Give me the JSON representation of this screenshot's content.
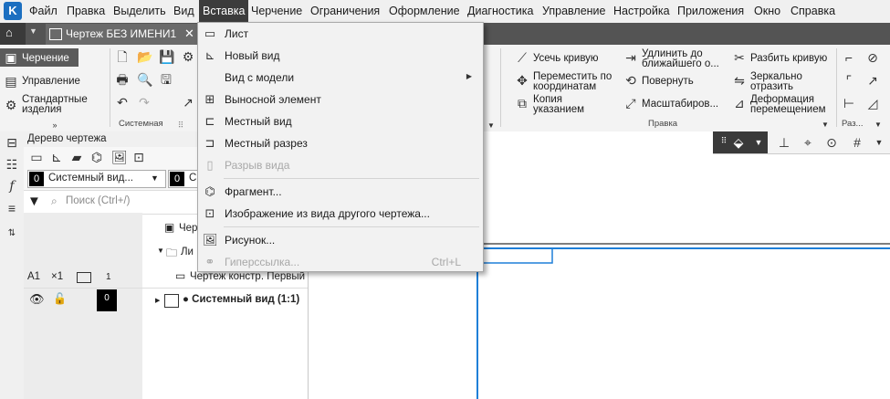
{
  "menubar": {
    "logo": "K",
    "items": [
      "Файл",
      "Правка",
      "Выделить",
      "Вид",
      "Вставка",
      "Черчение",
      "Ограничения",
      "Оформление",
      "Диагностика",
      "Управление",
      "Настройка",
      "Приложения",
      "Окно",
      "Справка"
    ]
  },
  "tabbar": {
    "doc_tab_label": "Чертеж БЕЗ ИМЕНИ1",
    "close": "✕"
  },
  "ribbon": {
    "panel_items": [
      "Черчение",
      "Управление",
      "Стандартные",
      "изделия"
    ],
    "group_sistemnaya": "Системная",
    "group_pravka": "Правка",
    "group_raz": "Раз...",
    "tools": {
      "usech": "Усечь кривую",
      "udlinit_1": "Удлинить до",
      "udlinit_2": "ближайшего о...",
      "razbit": "Разбить кривую",
      "peremestit_1": "Переместить по",
      "peremestit_2": "координатам",
      "povernut": "Повернуть",
      "zerkalno_1": "Зеркально",
      "zerkalno_2": "отразить",
      "kopiya_1": "Копия",
      "kopiya_2": "указанием",
      "masshtab": "Масштабиров...",
      "deform_1": "Деформация",
      "deform_2": "перемещением"
    }
  },
  "tree": {
    "header": "Дерево чертежа",
    "view_combo": "Системный вид...",
    "layer_num": "0",
    "layer_text": "С",
    "search_placeholder": "Поиск (Ctrl+/)",
    "row1": "Чер",
    "row2": "Ли",
    "row3": "Чертеж констр. Первый",
    "sheet_format": "A1",
    "sheet_scale": "×1",
    "sheet_num": "1",
    "view_num": "0",
    "view_row": "● Системный вид (1:1)"
  },
  "dropdown": {
    "items": [
      {
        "label": "Лист",
        "icon": "sheet-icon"
      },
      {
        "label": "Новый вид",
        "icon": "new-view-icon"
      },
      {
        "label": "Вид с модели",
        "icon": "",
        "submenu": true
      },
      {
        "label": "Выносной элемент",
        "icon": "detail-element-icon"
      },
      {
        "label": "Местный вид",
        "icon": "local-view-icon"
      },
      {
        "label": "Местный разрез",
        "icon": "local-section-icon"
      },
      {
        "label": "Разрыв вида",
        "icon": "break-view-icon",
        "disabled": true
      },
      {
        "label": "Фрагмент...",
        "icon": "fragment-icon"
      },
      {
        "label": "Изображение из вида другого чертежа...",
        "icon": "image-from-view-icon"
      },
      {
        "label": "Рисунок...",
        "icon": "picture-icon"
      },
      {
        "label": "Гиперссылка...",
        "icon": "hyperlink-icon",
        "disabled": true,
        "shortcut": "Ctrl+L"
      }
    ]
  },
  "colors": {
    "accent": "#1e7fd8",
    "menubar_active": "#3c3c3c",
    "tabbar": "#545454"
  }
}
